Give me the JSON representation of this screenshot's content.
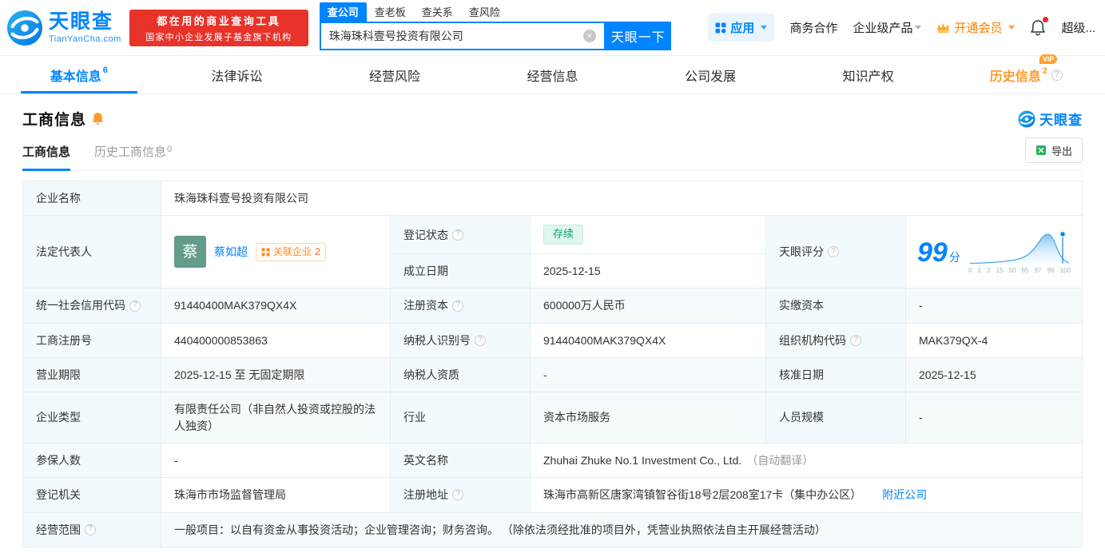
{
  "colors": {
    "accent": "#0084ff",
    "vip_orange": "#ff9a2e",
    "promo_red": "#e7332a",
    "status_green": "#00aa6e"
  },
  "misc": {
    "qmark": "?",
    "vip": "VIP"
  },
  "icons": {
    "clear": "✕"
  },
  "header": {
    "logo": {
      "brand": "天眼查",
      "domain": "TianYanCha.com"
    },
    "promo": {
      "line1": "都在用的商业查询工具",
      "line2": "国家中小企业发展子基金旗下机构"
    },
    "search_tabs": [
      {
        "label": "查公司"
      },
      {
        "label": "查老板"
      },
      {
        "label": "查关系"
      },
      {
        "label": "查风险"
      }
    ],
    "search": {
      "value": "珠海珠科壹号投资有限公司",
      "button": "天眼一下"
    },
    "menu": {
      "apps": "应用",
      "cooperation": "商务合作",
      "enterprise": "企业级产品",
      "vip": "开通会员",
      "super": "超级..."
    }
  },
  "nav_tabs": [
    {
      "label": "基本信息",
      "count": "6"
    },
    {
      "label": "法律诉讼"
    },
    {
      "label": "经营风险"
    },
    {
      "label": "经营信息"
    },
    {
      "label": "公司发展"
    },
    {
      "label": "知识产权"
    },
    {
      "label": "历史信息",
      "count": "2"
    }
  ],
  "section": {
    "title": "工商信息",
    "watermark": "天眼查"
  },
  "sub_tabs": {
    "current": "工商信息",
    "history": "历史工商信息",
    "history_count": "0"
  },
  "export_label": "导出",
  "table": {
    "company_name": {
      "label": "企业名称",
      "value": "珠海珠科壹号投资有限公司"
    },
    "legal_rep": {
      "label": "法定代表人",
      "avatar": "蔡",
      "name": "蔡如超",
      "related": "关联企业",
      "related_count": "2"
    },
    "reg_status": {
      "label": "登记状态",
      "value": "存续"
    },
    "establish_date": {
      "label": "成立日期",
      "value": "2025-12-15"
    },
    "score": {
      "label": "天眼评分",
      "value": "99",
      "unit": "分",
      "axis": [
        "0",
        "1",
        "3",
        "15",
        "50",
        "85",
        "97",
        "99",
        "100"
      ]
    },
    "credit_code": {
      "label": "统一社会信用代码",
      "value": "91440400MAK379QX4X"
    },
    "reg_capital": {
      "label": "注册资本",
      "value": "600000万人民币"
    },
    "paid_capital": {
      "label": "实缴资本",
      "value": "-"
    },
    "reg_number": {
      "label": "工商注册号",
      "value": "440400000853863"
    },
    "taxpayer_id": {
      "label": "纳税人识别号",
      "value": "91440400MAK379QX4X"
    },
    "org_code": {
      "label": "组织机构代码",
      "value": "MAK379QX-4"
    },
    "business_term": {
      "label": "营业期限",
      "value": "2025-12-15 至 无固定期限"
    },
    "taxpayer_quality": {
      "label": "纳税人资质",
      "value": "-"
    },
    "approval_date": {
      "label": "核准日期",
      "value": "2025-12-15"
    },
    "company_type": {
      "label": "企业类型",
      "value": "有限责任公司（非自然人投资或控股的法人独资）"
    },
    "industry": {
      "label": "行业",
      "value": "资本市场服务"
    },
    "staff_size": {
      "label": "人员规模",
      "value": "-"
    },
    "insured_count": {
      "label": "参保人数",
      "value": "-"
    },
    "english_name": {
      "label": "英文名称",
      "value": "Zhuhai Zhuke No.1 Investment Co., Ltd.",
      "note": "（自动翻译）"
    },
    "reg_authority": {
      "label": "登记机关",
      "value": "珠海市市场监督管理局"
    },
    "reg_address": {
      "label": "注册地址",
      "value": "珠海市高新区唐家湾镇智谷街18号2层208室17卡（集中办公区）",
      "link": "附近公司"
    },
    "business_scope": {
      "label": "经营范围",
      "value": "一般项目：以自有资金从事投资活动；企业管理咨询；财务咨询。 （除依法须经批准的项目外，凭营业执照依法自主开展经营活动）"
    }
  }
}
